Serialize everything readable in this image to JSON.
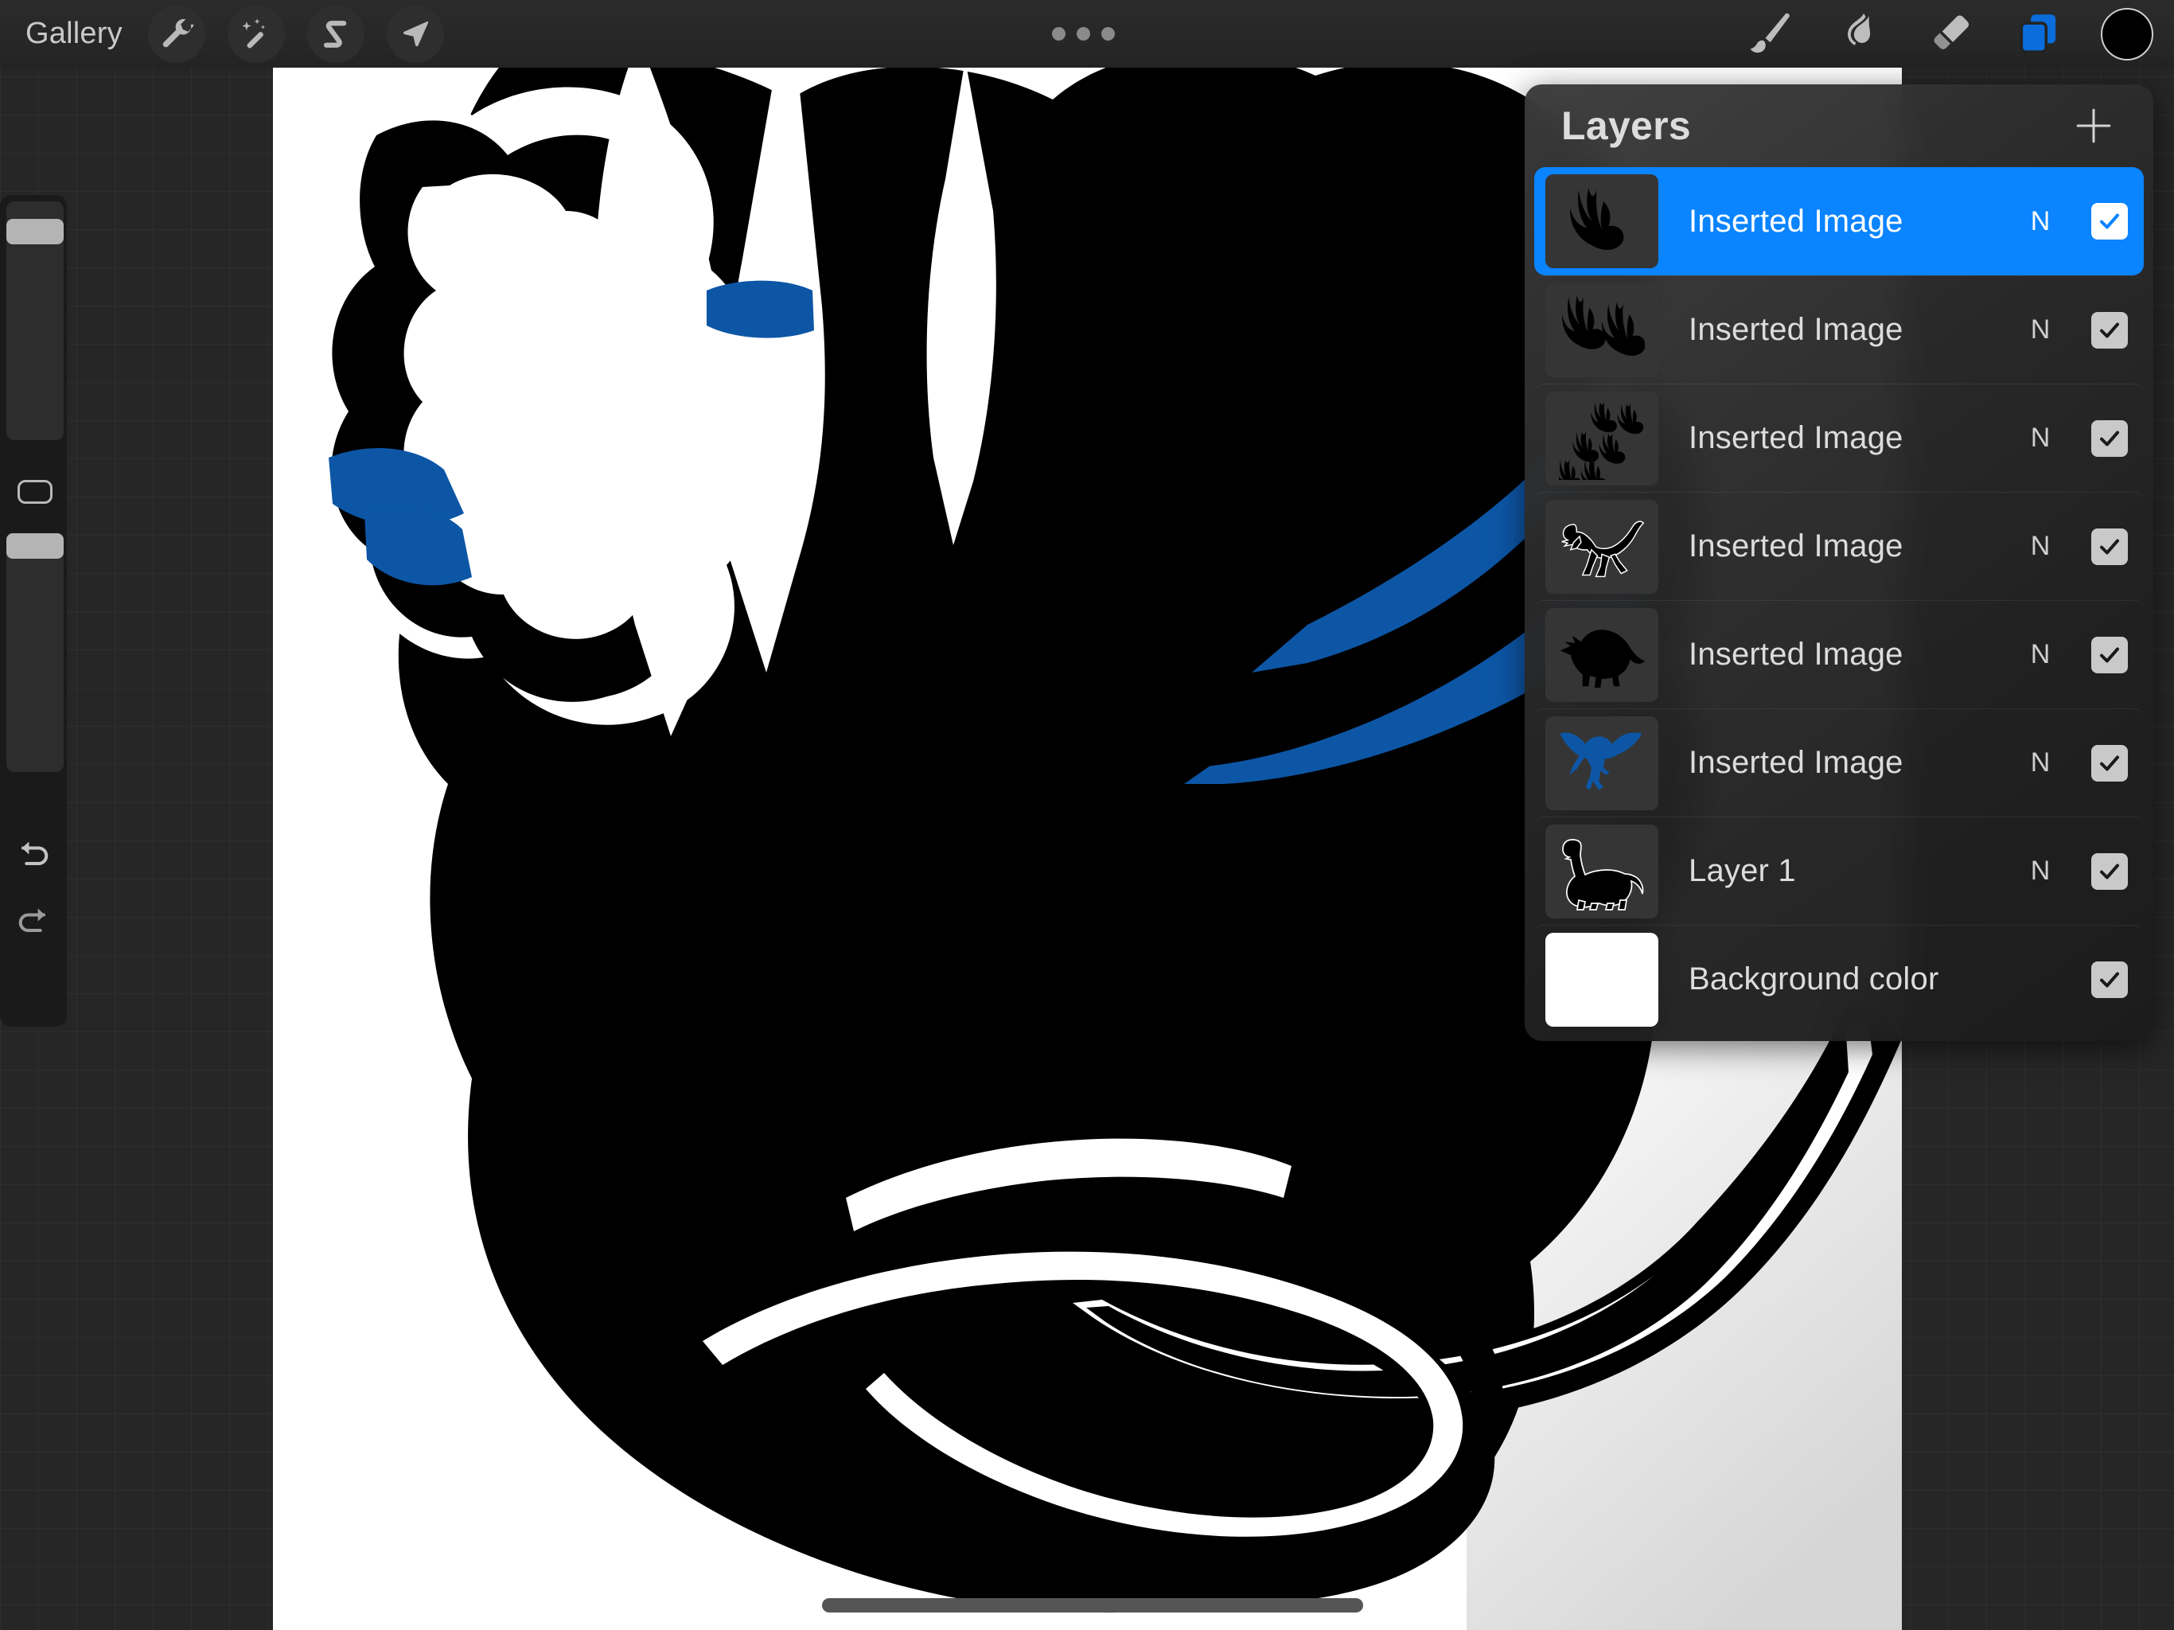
{
  "app": {
    "name": "Procreate",
    "accent_blue": "#0a84ff",
    "artwork_blue": "#0D56A6",
    "canvas_background": "#ffffff",
    "ui_background": "#262626"
  },
  "topbar": {
    "gallery_label": "Gallery",
    "left_tools": [
      {
        "name": "actions-wrench-icon",
        "icon": "wrench"
      },
      {
        "name": "adjustments-magic-wand-icon",
        "icon": "magic-wand"
      },
      {
        "name": "selection-s-curve-icon",
        "icon": "s-curve"
      },
      {
        "name": "transform-arrow-icon",
        "icon": "arrow"
      }
    ],
    "more_dots": "•••",
    "right_tools": [
      {
        "name": "paint-brush-icon",
        "icon": "brush"
      },
      {
        "name": "smudge-icon",
        "icon": "smudge"
      },
      {
        "name": "eraser-icon",
        "icon": "eraser"
      },
      {
        "name": "layers-icon",
        "icon": "layers",
        "active": true
      }
    ],
    "color_swatch": "#000000"
  },
  "sidebar": {
    "brush_size_slider": {
      "label": "Brush size",
      "value_percent": 92
    },
    "modify_button": {
      "label": "Modify"
    },
    "opacity_slider": {
      "label": "Opacity",
      "value_percent": 100
    },
    "undo_label": "Undo",
    "redo_label": "Redo"
  },
  "layers_panel": {
    "title": "Layers",
    "add_label": "+",
    "rows": [
      {
        "name": "Inserted Image",
        "blend_mode": "N",
        "visible": true,
        "selected": true,
        "thumb": "footprint-single",
        "thumb_color": "#000000"
      },
      {
        "name": "Inserted Image",
        "blend_mode": "N",
        "visible": true,
        "selected": false,
        "thumb": "footprint-pair",
        "thumb_color": "#000000"
      },
      {
        "name": "Inserted Image",
        "blend_mode": "N",
        "visible": true,
        "selected": false,
        "thumb": "footprint-trail",
        "thumb_color": "#000000"
      },
      {
        "name": "Inserted Image",
        "blend_mode": "N",
        "visible": true,
        "selected": false,
        "thumb": "trex",
        "thumb_color": "#000000"
      },
      {
        "name": "Inserted Image",
        "blend_mode": "N",
        "visible": true,
        "selected": false,
        "thumb": "triceratops",
        "thumb_color": "#000000"
      },
      {
        "name": "Inserted Image",
        "blend_mode": "N",
        "visible": true,
        "selected": false,
        "thumb": "pterodactyl",
        "thumb_color": "#0D56A6"
      },
      {
        "name": "Layer 1",
        "blend_mode": "N",
        "visible": true,
        "selected": false,
        "thumb": "brontosaurus",
        "thumb_color": "#000000"
      },
      {
        "name": "Background color",
        "blend_mode": "",
        "visible": true,
        "selected": false,
        "thumb": "solid-white",
        "thumb_color": "#ffffff"
      }
    ]
  },
  "canvas": {
    "description": "Black and white dinosaur line art with blue accents"
  }
}
